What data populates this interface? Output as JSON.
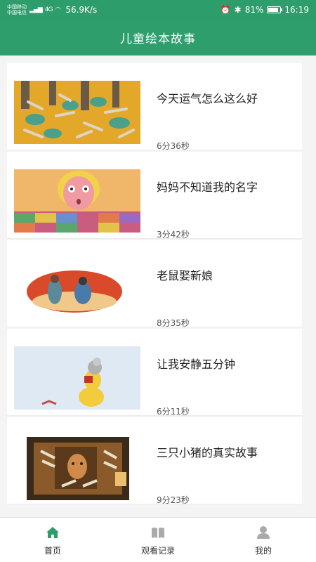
{
  "status_bar": {
    "carrier_1": "中国移动",
    "carrier_2": "中国电信",
    "signal_label": "4G",
    "network_speed": "56.9K/s",
    "battery": "81%",
    "battery_level": 0.81,
    "time": "16:19"
  },
  "app_bar": {
    "title": "儿童绘本故事"
  },
  "stories": [
    {
      "title": "今天运气怎么这么好",
      "duration": "6分36秒"
    },
    {
      "title": "妈妈不知道我的名字",
      "duration": "3分42秒"
    },
    {
      "title": "老鼠娶新娘",
      "duration": "8分35秒"
    },
    {
      "title": "让我安静五分钟",
      "duration": "6分11秒"
    },
    {
      "title": "三只小猪的真实故事",
      "duration": "9分23秒"
    }
  ],
  "tab_bar": {
    "items": [
      {
        "label": "首页",
        "icon": "home-icon",
        "active": true
      },
      {
        "label": "观看记录",
        "icon": "book-icon",
        "active": false
      },
      {
        "label": "我的",
        "icon": "person-icon",
        "active": false
      }
    ],
    "active_color": "#2e9e6c",
    "inactive_color": "#aaaaaa"
  },
  "colors": {
    "brand": "#2e9e6c"
  }
}
